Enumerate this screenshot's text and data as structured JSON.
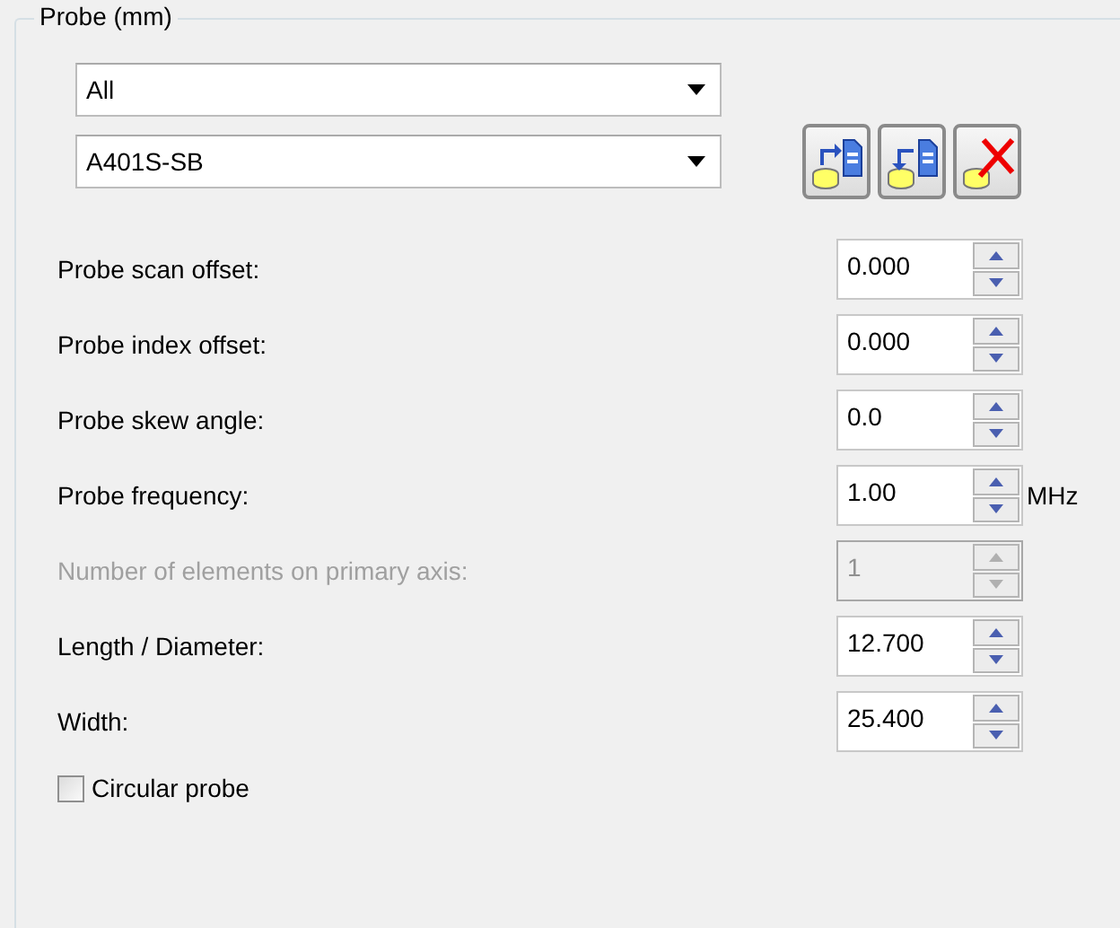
{
  "group": {
    "title": "Probe (mm)"
  },
  "selectors": [
    {
      "value": "All"
    },
    {
      "value": "A401S-SB"
    }
  ],
  "tool_buttons": [
    {
      "kind": "export"
    },
    {
      "kind": "import"
    },
    {
      "kind": "delete"
    }
  ],
  "fields": [
    {
      "label": "Probe scan offset:",
      "value": "0.000",
      "disabled": false
    },
    {
      "label": "Probe index offset:",
      "value": "0.000",
      "disabled": false
    },
    {
      "label": "Probe skew angle:",
      "value": "0.0",
      "disabled": false
    },
    {
      "label": "Probe frequency:",
      "value": "1.00",
      "unit": "MHz",
      "disabled": false
    },
    {
      "label": "Number of elements on primary axis:",
      "value": "1",
      "disabled": true
    },
    {
      "label": "Length / Diameter:",
      "value": "12.700",
      "disabled": false
    },
    {
      "label": "Width:",
      "value": "25.400",
      "disabled": false
    }
  ],
  "circular_probe": {
    "label": "Circular probe",
    "checked": false
  }
}
